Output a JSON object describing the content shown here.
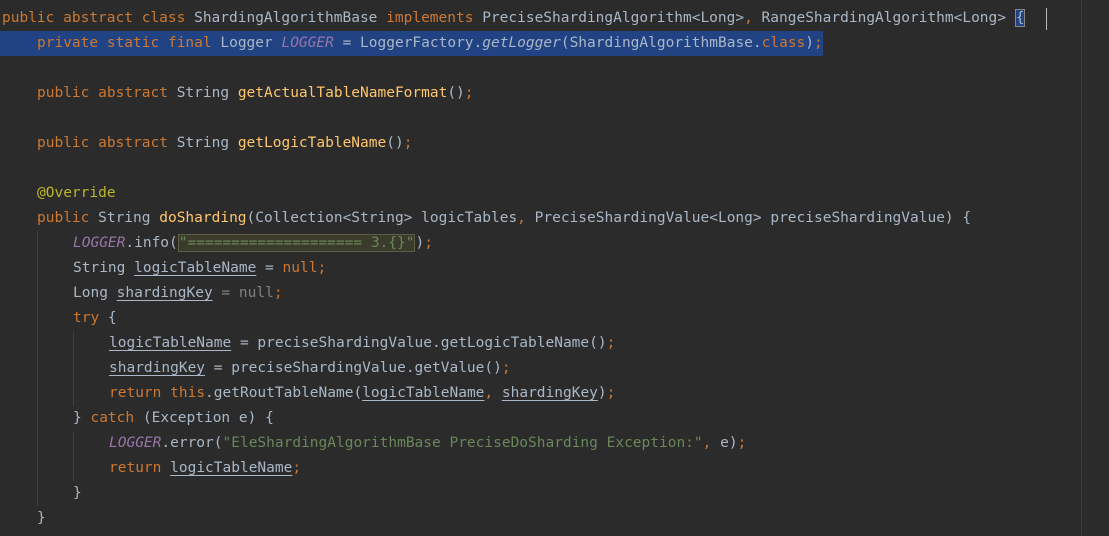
{
  "editor": {
    "language": "java",
    "theme": "darcula",
    "lines": [
      [
        "public",
        " ",
        "abstract",
        " ",
        "class",
        " ShardingAlgorithmBase ",
        "implements",
        " PreciseShardingAlgorithm<Long>",
        ",",
        " RangeShardingAlgorithm<Long> ",
        "{"
      ],
      [
        "private",
        " ",
        "static",
        " ",
        "final",
        " Logger ",
        "LOGGER",
        " = LoggerFactory.",
        "getLogger",
        "(ShardingAlgorithmBase.",
        "class",
        ")",
        ";"
      ],
      [],
      [
        "public",
        " ",
        "abstract",
        " String ",
        "getActualTableNameFormat",
        "()",
        ";"
      ],
      [],
      [
        "public",
        " ",
        "abstract",
        " String ",
        "getLogicTableName",
        "()",
        ";"
      ],
      [],
      [
        "@Override"
      ],
      [
        "public",
        " String ",
        "doSharding",
        "(Collection<String> logicTables",
        ",",
        " PreciseShardingValue<Long> preciseShardingValue) {"
      ],
      [
        "LOGGER",
        ".info(",
        "\"==================== 3.{}\"",
        ")",
        ";"
      ],
      [
        "String ",
        "logicTableName",
        " = ",
        "null",
        ";"
      ],
      [
        "Long ",
        "shardingKey",
        " = ",
        "null",
        ";"
      ],
      [
        "try",
        " {"
      ],
      [
        "logicTableName",
        " = preciseShardingValue.getLogicTableName()",
        ";"
      ],
      [
        "shardingKey",
        " = preciseShardingValue.getValue()",
        ";"
      ],
      [
        "return",
        " ",
        "this",
        ".getRoutTableName(",
        "logicTableName",
        ",",
        " ",
        "shardingKey",
        ")",
        ";"
      ],
      [
        "} ",
        "catch",
        " (Exception e) {"
      ],
      [
        "LOGGER",
        ".error(",
        "\"EleShardingAlgorithmBase PreciseDoSharding Exception:\"",
        ",",
        " e)",
        ";"
      ],
      [
        "return",
        " ",
        "logicTableName",
        ";"
      ],
      [
        "}"
      ],
      [
        "}"
      ]
    ]
  }
}
